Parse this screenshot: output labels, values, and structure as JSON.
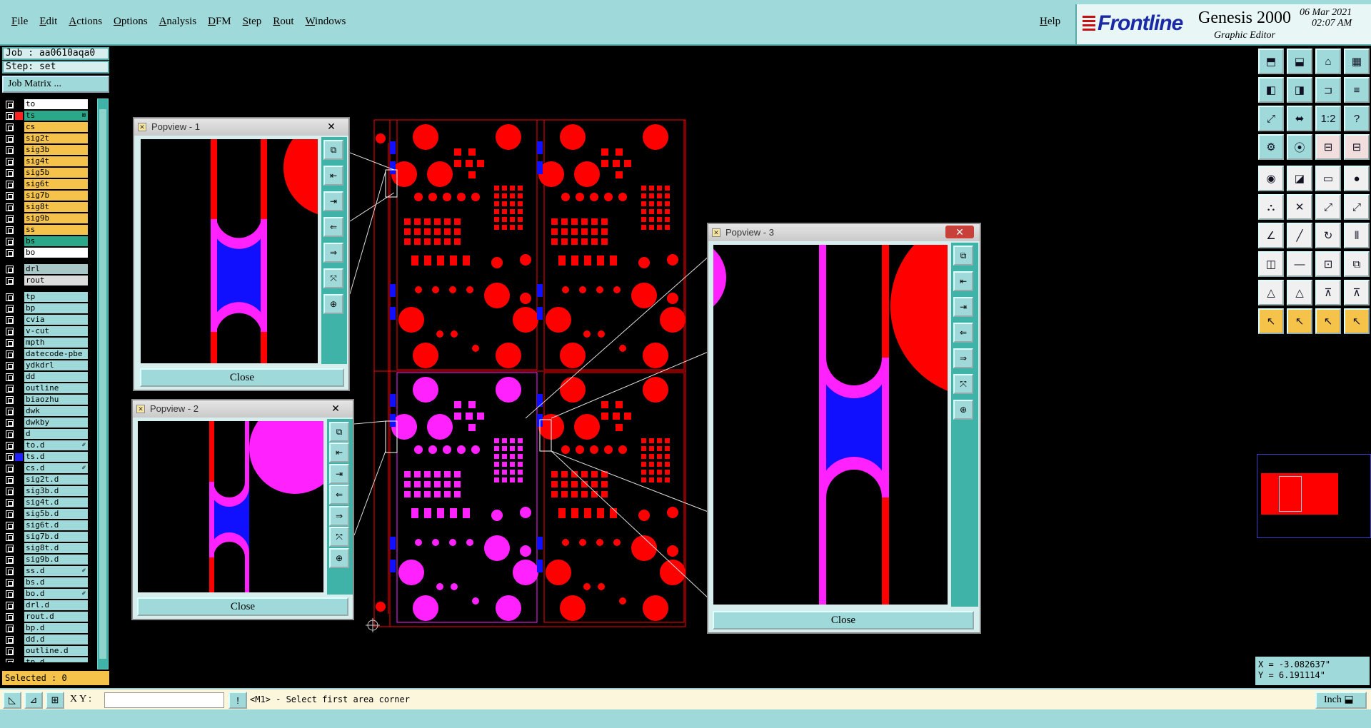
{
  "menubar": {
    "items": [
      "File",
      "Edit",
      "Actions",
      "Options",
      "Analysis",
      "DFM",
      "Step",
      "Rout",
      "Windows"
    ],
    "help": "Help"
  },
  "brand": {
    "logo": "Frontline",
    "product": "Genesis 2000",
    "subtitle": "Graphic Editor",
    "date": "06 Mar 2021",
    "time": "02:07 AM"
  },
  "left": {
    "job": "Job : aa0610aqa0",
    "step": "Step: set",
    "job_matrix": "Job Matrix ...",
    "selected": "Selected : 0",
    "layers": [
      {
        "name": "to",
        "bg": "#ffffff",
        "color": ""
      },
      {
        "name": "ts",
        "bg": "#2aa889",
        "color": "#ff2020",
        "mark": "⊠"
      },
      {
        "name": "cs",
        "bg": "#f5c24a",
        "color": ""
      },
      {
        "name": "sig2t",
        "bg": "#f5c24a",
        "color": ""
      },
      {
        "name": "sig3b",
        "bg": "#f5c24a",
        "color": ""
      },
      {
        "name": "sig4t",
        "bg": "#f5c24a",
        "color": ""
      },
      {
        "name": "sig5b",
        "bg": "#f5c24a",
        "color": ""
      },
      {
        "name": "sig6t",
        "bg": "#f5c24a",
        "color": ""
      },
      {
        "name": "sig7b",
        "bg": "#f5c24a",
        "color": ""
      },
      {
        "name": "sig8t",
        "bg": "#f5c24a",
        "color": ""
      },
      {
        "name": "sig9b",
        "bg": "#f5c24a",
        "color": ""
      },
      {
        "name": "ss",
        "bg": "#f5c24a",
        "color": ""
      },
      {
        "name": "bs",
        "bg": "#2aa889",
        "color": ""
      },
      {
        "name": "bo",
        "bg": "#ffffff",
        "color": ""
      },
      {
        "name": "drl",
        "bg": "#a9c7c7",
        "color": "",
        "gap": true
      },
      {
        "name": "rout",
        "bg": "#dcdcdc",
        "color": ""
      },
      {
        "name": "tp",
        "bg": "#9fd9d9",
        "color": "",
        "gap": true
      },
      {
        "name": "bp",
        "bg": "#9fd9d9",
        "color": ""
      },
      {
        "name": "cvia",
        "bg": "#9fd9d9",
        "color": ""
      },
      {
        "name": "v-cut",
        "bg": "#9fd9d9",
        "color": ""
      },
      {
        "name": "mpth",
        "bg": "#9fd9d9",
        "color": ""
      },
      {
        "name": "datecode-pbe",
        "bg": "#9fd9d9",
        "color": ""
      },
      {
        "name": "ydkdrl",
        "bg": "#9fd9d9",
        "color": ""
      },
      {
        "name": "dd",
        "bg": "#9fd9d9",
        "color": ""
      },
      {
        "name": "outline",
        "bg": "#9fd9d9",
        "color": ""
      },
      {
        "name": "biaozhu",
        "bg": "#9fd9d9",
        "color": ""
      },
      {
        "name": "dwk",
        "bg": "#9fd9d9",
        "color": ""
      },
      {
        "name": "dwkby",
        "bg": "#9fd9d9",
        "color": ""
      },
      {
        "name": "d",
        "bg": "#9fd9d9",
        "color": ""
      },
      {
        "name": "to.d",
        "bg": "#9fd9d9",
        "color": "",
        "mark": "✐"
      },
      {
        "name": "ts.d",
        "bg": "#9fd9d9",
        "color": "#2020ff"
      },
      {
        "name": "cs.d",
        "bg": "#9fd9d9",
        "color": "",
        "mark": "✐"
      },
      {
        "name": "sig2t.d",
        "bg": "#9fd9d9",
        "color": ""
      },
      {
        "name": "sig3b.d",
        "bg": "#9fd9d9",
        "color": ""
      },
      {
        "name": "sig4t.d",
        "bg": "#9fd9d9",
        "color": ""
      },
      {
        "name": "sig5b.d",
        "bg": "#9fd9d9",
        "color": ""
      },
      {
        "name": "sig6t.d",
        "bg": "#9fd9d9",
        "color": ""
      },
      {
        "name": "sig7b.d",
        "bg": "#9fd9d9",
        "color": ""
      },
      {
        "name": "sig8t.d",
        "bg": "#9fd9d9",
        "color": ""
      },
      {
        "name": "sig9b.d",
        "bg": "#9fd9d9",
        "color": ""
      },
      {
        "name": "ss.d",
        "bg": "#9fd9d9",
        "color": "",
        "mark": "✐"
      },
      {
        "name": "bs.d",
        "bg": "#9fd9d9",
        "color": ""
      },
      {
        "name": "bo.d",
        "bg": "#9fd9d9",
        "color": "",
        "mark": "✐"
      },
      {
        "name": "drl.d",
        "bg": "#9fd9d9",
        "color": ""
      },
      {
        "name": "rout.d",
        "bg": "#9fd9d9",
        "color": ""
      },
      {
        "name": "bp.d",
        "bg": "#9fd9d9",
        "color": ""
      },
      {
        "name": "dd.d",
        "bg": "#9fd9d9",
        "color": ""
      },
      {
        "name": "outline.d",
        "bg": "#9fd9d9",
        "color": ""
      },
      {
        "name": "tp.d",
        "bg": "#9fd9d9",
        "color": ""
      }
    ]
  },
  "popviews": [
    {
      "title": "Popview - 1",
      "close_label": "Close"
    },
    {
      "title": "Popview - 2",
      "close_label": "Close"
    },
    {
      "title": "Popview - 3",
      "close_label": "Close"
    }
  ],
  "coords": {
    "x": "X = -3.082637\"",
    "y": "Y = 6.191114\""
  },
  "status": {
    "xy_label": "X Y :",
    "xy_value": "",
    "message": "<M1> - Select first area corner",
    "units": "Inch"
  },
  "colors": {
    "copper": "#ff0000",
    "magenta": "#ff22ff",
    "blue": "#1010ff",
    "panel": "#9fd9d9",
    "highlight": "#f5c24a"
  }
}
